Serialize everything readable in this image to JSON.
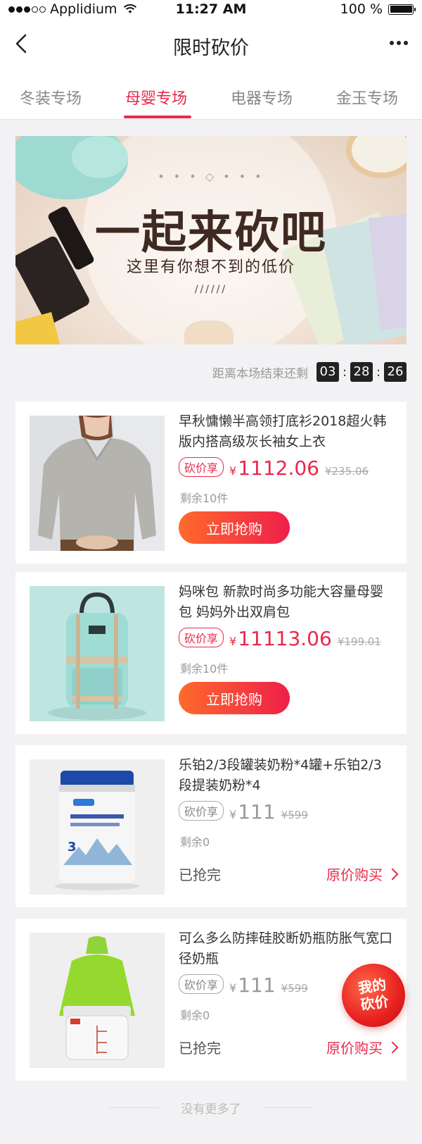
{
  "status_bar": {
    "carrier": "Applidium",
    "time": "11:27 AM",
    "battery": "100 %",
    "signal_icon": "signal-dots-icon",
    "wifi_icon": "wifi-icon",
    "battery_icon": "battery-icon"
  },
  "nav": {
    "title": "限时砍价",
    "back_icon": "chevron-left-icon",
    "more_icon": "more-dots-icon"
  },
  "tabs": [
    {
      "label": "冬装专场",
      "active": false
    },
    {
      "label": "母婴专场",
      "active": true
    },
    {
      "label": "电器专场",
      "active": false
    },
    {
      "label": "金玉专场",
      "active": false
    }
  ],
  "banner": {
    "headline": "一起来砍吧",
    "subline": "这里有你想不到的低价",
    "deco": "• • • ◇ • • •",
    "slashes": "//////"
  },
  "countdown": {
    "label": "距离本场结束还剩",
    "hours": "03",
    "minutes": "28",
    "seconds": "26"
  },
  "products": [
    {
      "title": "早秋慵懒半高领打底衫2018超火韩版内搭高级灰长袖女上衣",
      "tag": "砍价享",
      "currency": "¥",
      "price": "1112.06",
      "original_price": "¥235.06",
      "remaining": "剩余10件",
      "action": "立即抢购",
      "available": true
    },
    {
      "title": "妈咪包  新款时尚多功能大容量母婴包 妈妈外出双肩包",
      "tag": "砍价享",
      "currency": "¥",
      "price": "11113.06",
      "original_price": "¥199.01",
      "remaining": "剩余10件",
      "action": "立即抢购",
      "available": true
    },
    {
      "title": "乐铂2/3段罐装奶粉*4罐+乐铂2/3段提装奶粉*4",
      "tag": "砍价享",
      "currency": "¥",
      "price": "111",
      "original_price": "¥599",
      "remaining": "剩余0",
      "sold_out": "已抢完",
      "original_buy": "原价购买",
      "available": false
    },
    {
      "title": "可么多么防摔硅胶断奶瓶防胀气宽口径奶瓶",
      "tag": "砍价享",
      "currency": "¥",
      "price": "111",
      "original_price": "¥599",
      "remaining": "剩余0",
      "sold_out": "已抢完",
      "original_buy": "原价购买",
      "available": false
    }
  ],
  "floating_button": {
    "line1": "我的",
    "line2": "砍价"
  },
  "footer": {
    "no_more": "没有更多了"
  },
  "colors": {
    "accent": "#e8294a",
    "button_gradient_start": "#ff6a2b",
    "button_gradient_end": "#ee1f4a"
  }
}
